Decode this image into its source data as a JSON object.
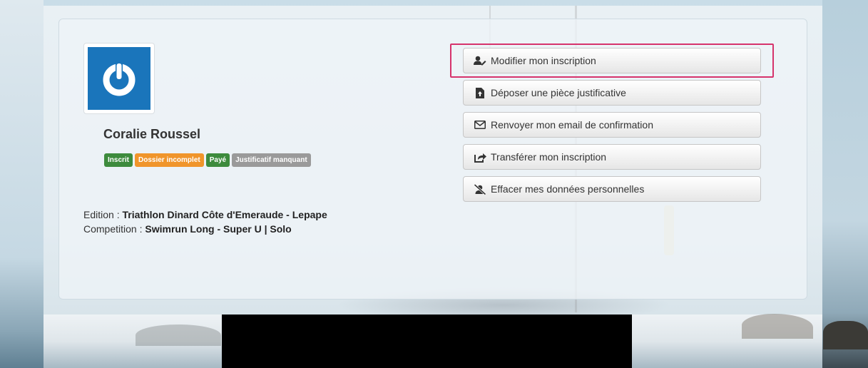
{
  "profile": {
    "name": "Coralie Roussel",
    "badges": [
      {
        "label": "Inscrit",
        "color": "#3d8b3d"
      },
      {
        "label": "Dossier incomplet",
        "color": "#f0952b"
      },
      {
        "label": "Payé",
        "color": "#3d8b3d"
      },
      {
        "label": "Justificatif manquant",
        "color": "#9a9a9a"
      }
    ],
    "avatar_icon": "power-icon",
    "avatar_color": "#1a75bb"
  },
  "info": {
    "edition_label": "Edition : ",
    "edition_value": "Triathlon Dinard Côte d'Emeraude - Lepape",
    "competition_label": "Competition : ",
    "competition_value": "Swimrun Long - Super U | Solo"
  },
  "actions": [
    {
      "label": "Modifier mon inscription",
      "icon": "user-edit-icon",
      "highlighted": true
    },
    {
      "label": "Déposer une pièce justificative",
      "icon": "file-upload-icon"
    },
    {
      "label": "Renvoyer mon email de confirmation",
      "icon": "envelope-icon"
    },
    {
      "label": "Transférer mon inscription",
      "icon": "share-icon"
    },
    {
      "label": "Effacer mes données personnelles",
      "icon": "user-slash-icon"
    }
  ],
  "colors": {
    "highlight": "#d6336c",
    "redacted": "#000000"
  }
}
